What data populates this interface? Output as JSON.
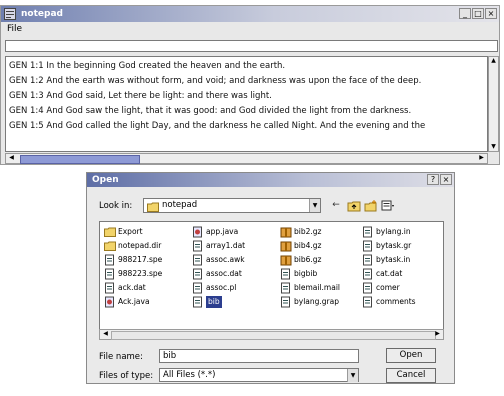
{
  "notepad": {
    "title": "notepad",
    "menu": [
      "File"
    ],
    "window_buttons": [
      "_",
      "□",
      "×"
    ],
    "search_value": "",
    "lines": [
      "GEN 1:1  In the beginning God created the heaven and the earth.",
      "GEN 1:2  And the earth was without form, and void; and darkness was upon the face of the deep.",
      "GEN 1:3  And God said, Let there be light: and there was light.",
      "GEN 1:4  And God saw the light, that it was good: and God divided the light from the darkness.",
      "GEN 1:5  And God called the light Day, and the darkness he called Night. And the evening and the"
    ]
  },
  "open_dialog": {
    "title": "Open",
    "window_buttons": [
      "?",
      "×"
    ],
    "look_in_label": "Look in:",
    "look_in_value": "notepad",
    "toolbar_icons": [
      "up-folder-icon",
      "home-icon",
      "new-folder-icon",
      "view-list-icon"
    ],
    "files": [
      {
        "name": "Export",
        "type": "folder"
      },
      {
        "name": "notepad.dir",
        "type": "folder"
      },
      {
        "name": "988217.spe",
        "type": "file"
      },
      {
        "name": "988223.spe",
        "type": "file"
      },
      {
        "name": "ack.dat",
        "type": "file"
      },
      {
        "name": "Ack.java",
        "type": "java"
      },
      {
        "name": "app.java",
        "type": "java"
      },
      {
        "name": "array1.dat",
        "type": "file"
      },
      {
        "name": "assoc.awk",
        "type": "file"
      },
      {
        "name": "assoc.dat",
        "type": "file"
      },
      {
        "name": "assoc.pl",
        "type": "file"
      },
      {
        "name": "bib",
        "type": "file",
        "selected": true
      },
      {
        "name": "bib2.gz",
        "type": "archive"
      },
      {
        "name": "bib4.gz",
        "type": "archive"
      },
      {
        "name": "bib6.gz",
        "type": "archive"
      },
      {
        "name": "bigbib",
        "type": "file"
      },
      {
        "name": "blemail.mail",
        "type": "file"
      },
      {
        "name": "bylang.grap",
        "type": "file"
      },
      {
        "name": "bylang.in",
        "type": "file"
      },
      {
        "name": "bytask.gr",
        "type": "file"
      },
      {
        "name": "bytask.in",
        "type": "file"
      },
      {
        "name": "cat.dat",
        "type": "file"
      },
      {
        "name": "comer",
        "type": "file"
      },
      {
        "name": "comments",
        "type": "file"
      }
    ],
    "file_name_label": "File name:",
    "file_name_value": "bib",
    "files_of_type_label": "Files of type:",
    "files_of_type_value": "All Files (*.*)",
    "open_button": "Open",
    "cancel_button": "Cancel"
  },
  "colors": {
    "selection": "#2c3e8f",
    "scroll_thumb": "#8e9ad6",
    "titlebar_start": "#6f7fb0"
  }
}
